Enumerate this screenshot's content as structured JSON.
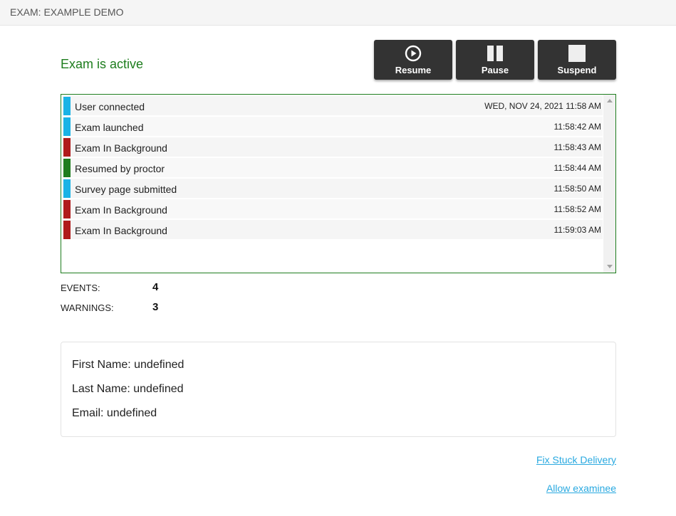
{
  "header": {
    "title": "EXAM: EXAMPLE DEMO"
  },
  "status": {
    "text": "Exam is active",
    "color": "#1e7d1e"
  },
  "controls": {
    "resume": {
      "label": "Resume",
      "icon": "play-circle-icon"
    },
    "pause": {
      "label": "Pause",
      "icon": "pause-icon"
    },
    "suspend": {
      "label": "Suspend",
      "icon": "stop-icon"
    }
  },
  "log": {
    "entries": [
      {
        "event": "User connected",
        "time": "WED, NOV 24, 2021 11:58 AM",
        "level": "info",
        "color": "#1ab3e6"
      },
      {
        "event": "Exam launched",
        "time": "11:58:42 AM",
        "level": "info",
        "color": "#1ab3e6"
      },
      {
        "event": "Exam In Background",
        "time": "11:58:43 AM",
        "level": "warning",
        "color": "#b01c1c"
      },
      {
        "event": "Resumed by proctor",
        "time": "11:58:44 AM",
        "level": "ok",
        "color": "#1e7d1e"
      },
      {
        "event": "Survey page submitted",
        "time": "11:58:50 AM",
        "level": "info",
        "color": "#1ab3e6"
      },
      {
        "event": "Exam In Background",
        "time": "11:58:52 AM",
        "level": "warning",
        "color": "#b01c1c"
      },
      {
        "event": "Exam In Background",
        "time": "11:59:03 AM",
        "level": "warning",
        "color": "#b01c1c"
      }
    ]
  },
  "stats": {
    "events_label": "EVENTS:",
    "events_value": "4",
    "warnings_label": "WARNINGS:",
    "warnings_value": "3"
  },
  "candidate": {
    "first_name": "First Name: undefined",
    "last_name": "Last Name: undefined",
    "email": "Email: undefined"
  },
  "links": {
    "fix": "Fix Stuck Delivery",
    "allow": "Allow examinee"
  }
}
